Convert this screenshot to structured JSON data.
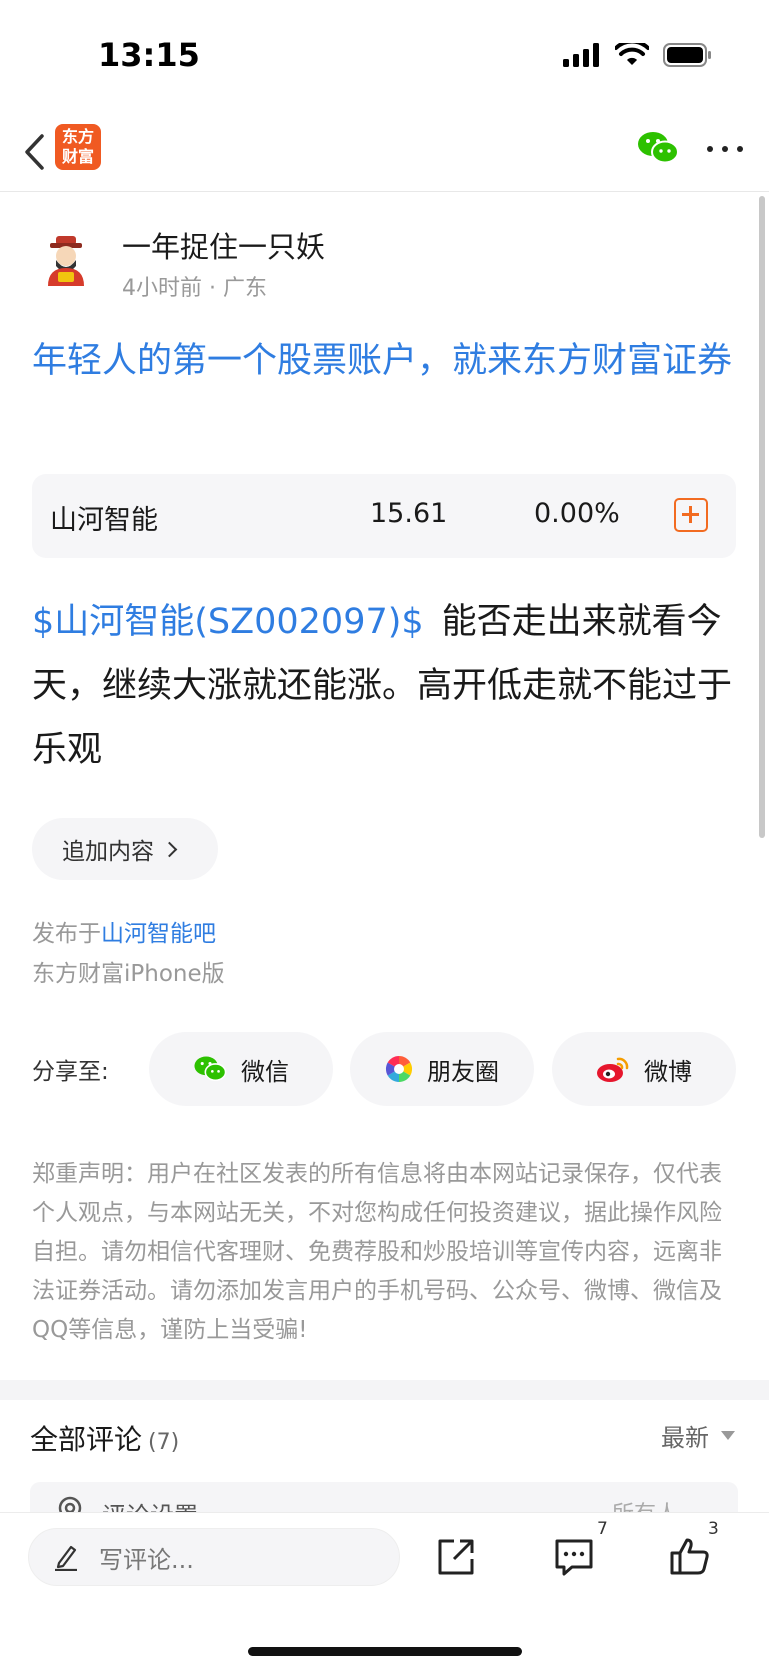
{
  "status_bar": {
    "time": "13:15"
  },
  "nav": {
    "logo_line1": "东方",
    "logo_line2": "财富"
  },
  "author": {
    "name": "一年捉住一只妖",
    "meta": "4小时前 · 广东"
  },
  "promo": {
    "text": "年轻人的第一个股票账户，就来东方财富证券"
  },
  "stock": {
    "name": "山河智能",
    "price": "15.61",
    "change": "0.00%"
  },
  "post": {
    "tag": "$山河智能(SZ002097)$",
    "text": "能否走出来就看今天，继续大涨就还能涨。高开低走就不能过于乐观"
  },
  "append": {
    "label": "追加内容"
  },
  "publish": {
    "prefix": "发布于",
    "board": "山河智能吧",
    "device": "东方财富iPhone版"
  },
  "share": {
    "label": "分享至:",
    "wechat": "微信",
    "moments": "朋友圈",
    "weibo": "微博"
  },
  "disclaimer": "郑重声明：用户在社区发表的所有信息将由本网站记录保存，仅代表个人观点，与本网站无关，不对您构成任何投资建议，据此操作风险自担。请勿相信代客理财、免费荐股和炒股培训等宣传内容，远离非法证券活动。请勿添加发言用户的手机号码、公众号、微博、微信及QQ等信息，谨防上当受骗!",
  "comments": {
    "title": "全部评论",
    "count": "(7)",
    "sort": "最新",
    "settings_label": "评论设置",
    "settings_value": "所有人"
  },
  "bottom_bar": {
    "input_placeholder": "写评论...",
    "comment_badge": "7",
    "like_badge": "3"
  },
  "colors": {
    "accent_blue": "#2f7de1",
    "brand_orange": "#f05a22",
    "wechat_green": "#2dc100",
    "weibo_red": "#e6162d"
  }
}
